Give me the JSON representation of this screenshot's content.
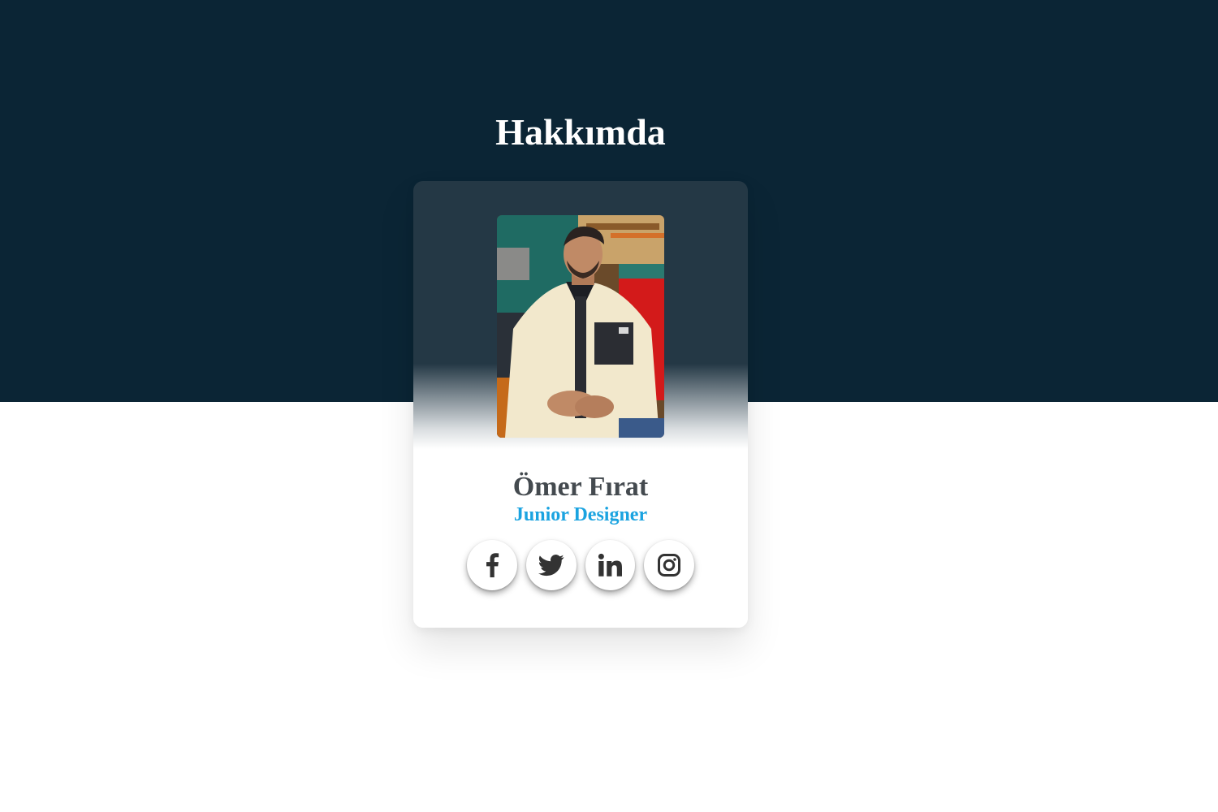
{
  "page": {
    "title": "Hakkımda"
  },
  "profile": {
    "name": "Ömer Fırat",
    "role": "Junior Designer",
    "photo_alt": "portrait-photo"
  },
  "socials": [
    {
      "icon": "facebook-icon"
    },
    {
      "icon": "twitter-icon"
    },
    {
      "icon": "linkedin-icon"
    },
    {
      "icon": "instagram-icon"
    }
  ],
  "colors": {
    "hero_bg": "#0b2535",
    "card_top": "#243845",
    "name": "#444a4f",
    "role_accent": "#1aa3e0",
    "icon": "#333333"
  }
}
